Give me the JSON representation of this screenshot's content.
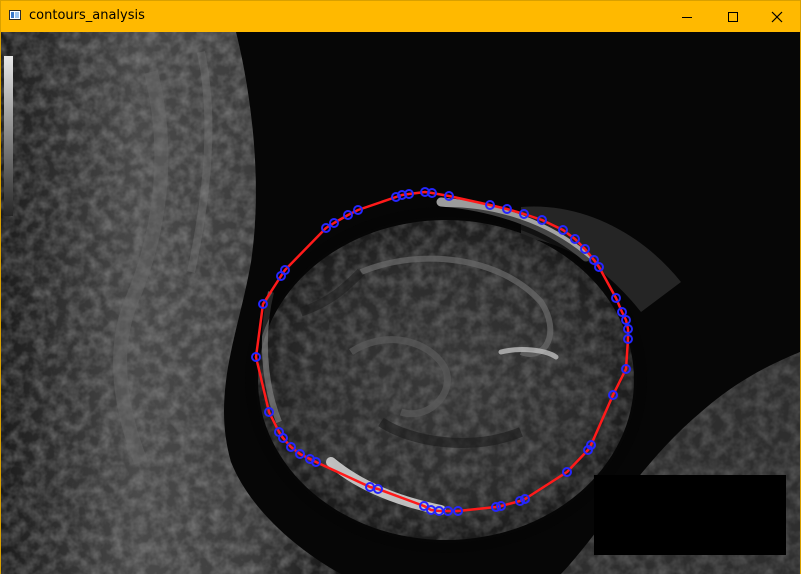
{
  "window": {
    "title": "contours_analysis",
    "colors": {
      "titlebar": "#ffb900",
      "contour_line": "#ff1a1a",
      "contour_points": "#2626ff"
    },
    "controls": {
      "minimize_icon": "minimize-icon",
      "maximize_icon": "maximize-icon",
      "close_icon": "close-icon"
    }
  },
  "image": {
    "description_icon": "ultrasound-image"
  }
}
